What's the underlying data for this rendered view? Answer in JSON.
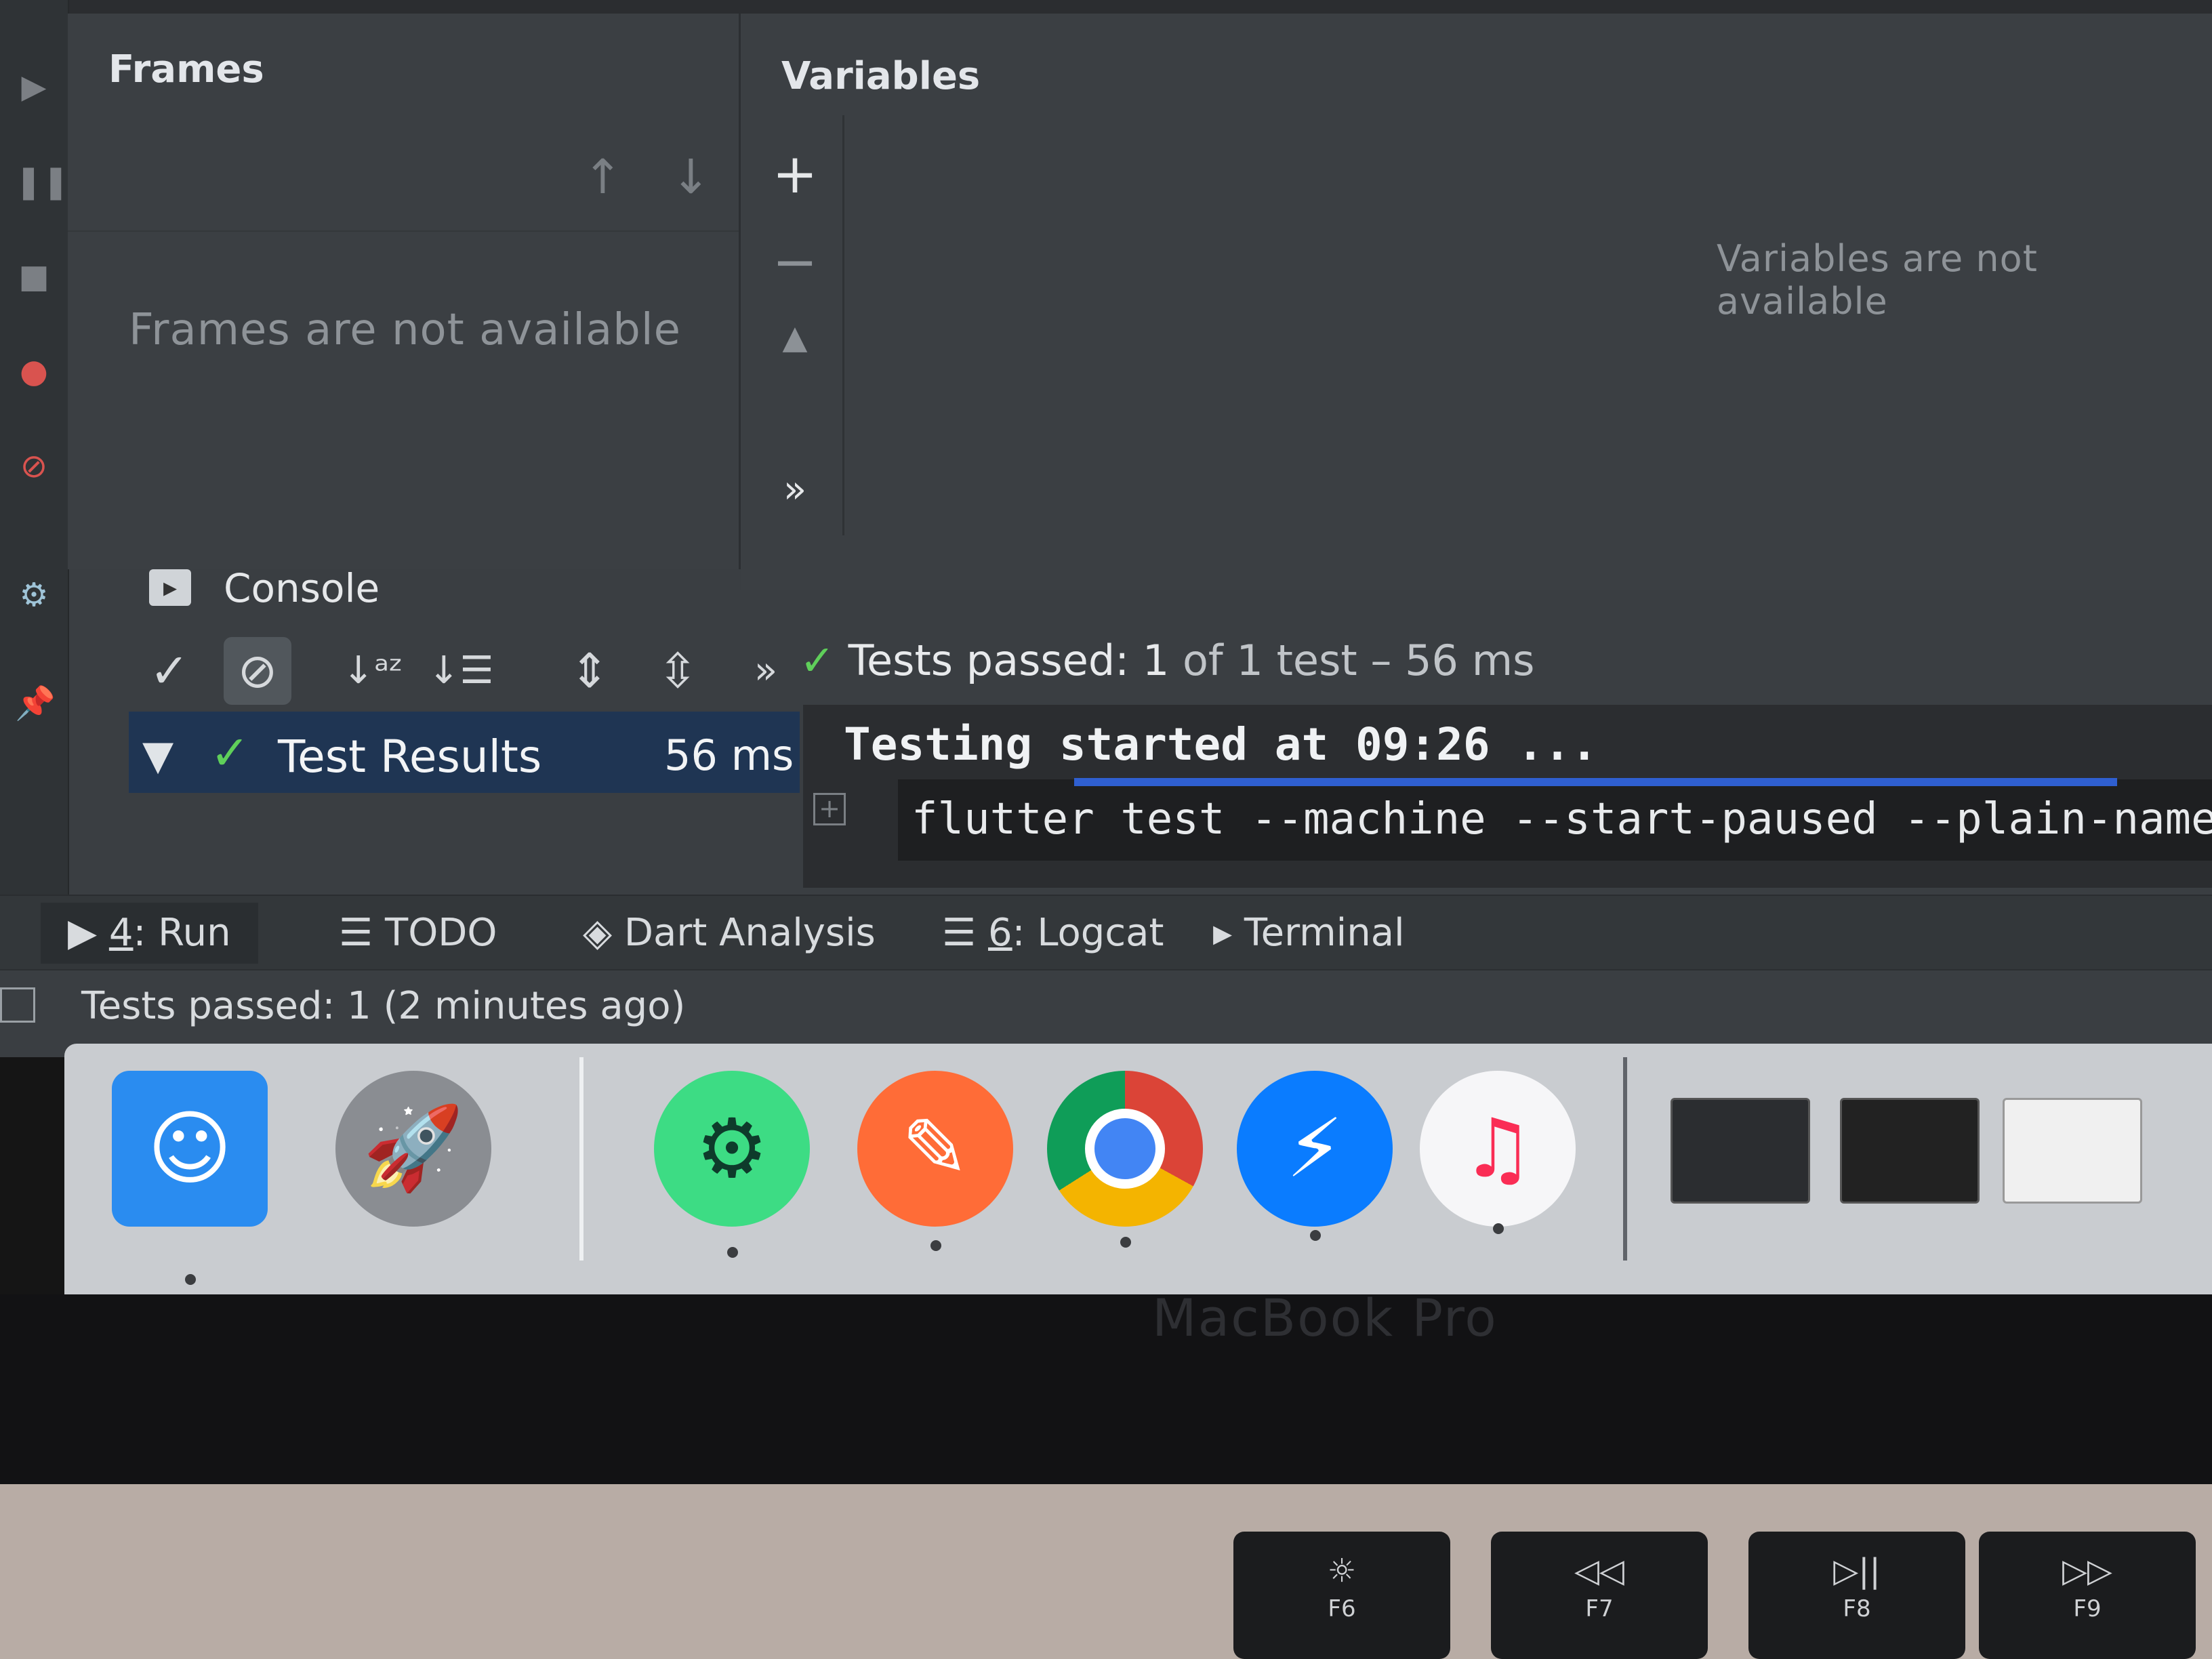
{
  "frames": {
    "title": "Frames",
    "empty_message": "Frames are not available",
    "up_label": "↑",
    "down_label": "↓"
  },
  "variables": {
    "title": "Variables",
    "empty_message": "Variables are not available",
    "add_label": "+",
    "remove_label": "−",
    "up_label": "▲",
    "more_label": "»"
  },
  "console": {
    "tab_label": "Console",
    "status_check": "✓",
    "status_text": "Tests passed: 1",
    "status_rest": " of 1 test – 56 ms",
    "more_label": "»",
    "line1": "Testing started at 09:26 ...",
    "line2": "flutter test --machine --start-paused --plain-name \""
  },
  "results": {
    "label": "Test Results",
    "time": "56 ms"
  },
  "bottom_tabs": [
    {
      "num": "4",
      "label": ": Run"
    },
    {
      "label": "TODO"
    },
    {
      "label": "Dart Analysis"
    },
    {
      "num": "6",
      "label": ": Logcat"
    },
    {
      "label": "Terminal"
    }
  ],
  "status_bar": {
    "text": "Tests passed: 1 (2 minutes ago)"
  },
  "dock": {
    "apps": [
      {
        "name": "Finder",
        "icon": "finder-icon",
        "color": "#2a8cf0"
      },
      {
        "name": "Launchpad",
        "icon": "launchpad-icon",
        "color": "#8a8d92"
      },
      {
        "name": "Android Studio",
        "icon": "android-studio-icon",
        "color": "#3ddc84"
      },
      {
        "name": "Postman",
        "icon": "postman-icon",
        "color": "#ff6c37"
      },
      {
        "name": "Chrome",
        "icon": "chrome-icon",
        "color": "#4285f4"
      },
      {
        "name": "Messenger",
        "icon": "messenger-icon",
        "color": "#0a7cff"
      },
      {
        "name": "Music",
        "icon": "music-icon",
        "color": "#fa2d55"
      }
    ]
  },
  "laptop": {
    "brand": "MacBook Pro",
    "keys": [
      {
        "symbol": "☼",
        "label": "F6"
      },
      {
        "symbol": "◁◁",
        "label": "F7"
      },
      {
        "symbol": "▷||",
        "label": "F8"
      },
      {
        "symbol": "▷▷",
        "label": "F9"
      }
    ]
  },
  "colors": {
    "accent_blue": "#2f5fd0",
    "pass_green": "#5fcf5a",
    "selection": "#1f3553"
  }
}
